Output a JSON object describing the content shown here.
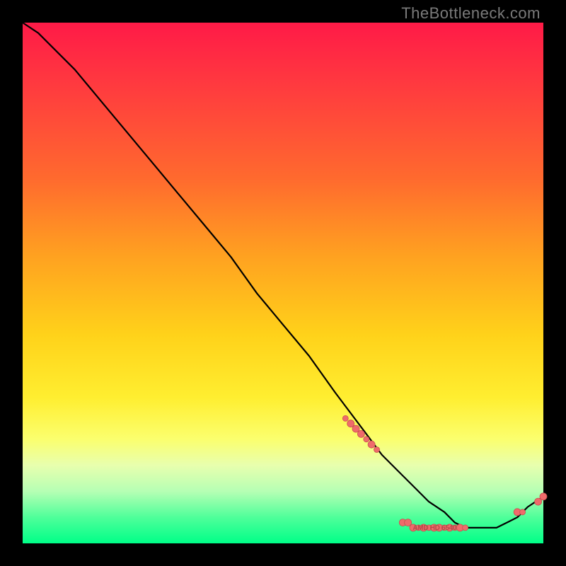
{
  "attribution": "TheBottleneck.com",
  "colors": {
    "frame": "#000000",
    "gradient_stops": [
      "#ff1a47",
      "#ff6a2e",
      "#ffd21a",
      "#fbff6e",
      "#00ff88"
    ],
    "curve": "#000000",
    "dot_fill": "#ef6b6b",
    "dot_stroke": "#c94f4f"
  },
  "chart_data": {
    "type": "line",
    "title": "",
    "xlabel": "",
    "ylabel": "",
    "x_range": [
      0,
      100
    ],
    "y_range": [
      0,
      100
    ],
    "grid": false,
    "legend": false,
    "series": [
      {
        "name": "bottleneck-curve",
        "x": [
          0,
          3,
          6,
          10,
          15,
          20,
          25,
          30,
          35,
          40,
          45,
          50,
          55,
          60,
          63,
          66,
          69,
          72,
          75,
          78,
          81,
          83,
          85,
          87,
          89,
          91,
          93,
          95,
          97,
          100
        ],
        "y": [
          100,
          98,
          95,
          91,
          85,
          79,
          73,
          67,
          61,
          55,
          48,
          42,
          36,
          29,
          25,
          21,
          17,
          14,
          11,
          8,
          6,
          4,
          3,
          3,
          3,
          3,
          4,
          5,
          7,
          9
        ]
      }
    ],
    "dots": [
      {
        "x": 62,
        "y": 24,
        "r": 4
      },
      {
        "x": 63,
        "y": 23,
        "r": 5
      },
      {
        "x": 64,
        "y": 22,
        "r": 5
      },
      {
        "x": 65,
        "y": 21,
        "r": 5
      },
      {
        "x": 66,
        "y": 20,
        "r": 4
      },
      {
        "x": 67,
        "y": 19,
        "r": 5
      },
      {
        "x": 68,
        "y": 18,
        "r": 4
      },
      {
        "x": 73,
        "y": 4,
        "r": 5
      },
      {
        "x": 74,
        "y": 4,
        "r": 5
      },
      {
        "x": 75,
        "y": 3,
        "r": 5
      },
      {
        "x": 76,
        "y": 3,
        "r": 4
      },
      {
        "x": 77,
        "y": 3,
        "r": 5
      },
      {
        "x": 78,
        "y": 3,
        "r": 4
      },
      {
        "x": 79,
        "y": 3,
        "r": 5
      },
      {
        "x": 80,
        "y": 3,
        "r": 5
      },
      {
        "x": 81,
        "y": 3,
        "r": 4
      },
      {
        "x": 82,
        "y": 3,
        "r": 5
      },
      {
        "x": 83,
        "y": 3,
        "r": 4
      },
      {
        "x": 84,
        "y": 3,
        "r": 5
      },
      {
        "x": 85,
        "y": 3,
        "r": 4
      },
      {
        "x": 95,
        "y": 6,
        "r": 5
      },
      {
        "x": 96,
        "y": 6,
        "r": 4
      },
      {
        "x": 99,
        "y": 8,
        "r": 5
      },
      {
        "x": 100,
        "y": 9,
        "r": 5
      }
    ],
    "annotation": {
      "text": "AMD HD 6540",
      "x": 79,
      "y": 3
    }
  }
}
